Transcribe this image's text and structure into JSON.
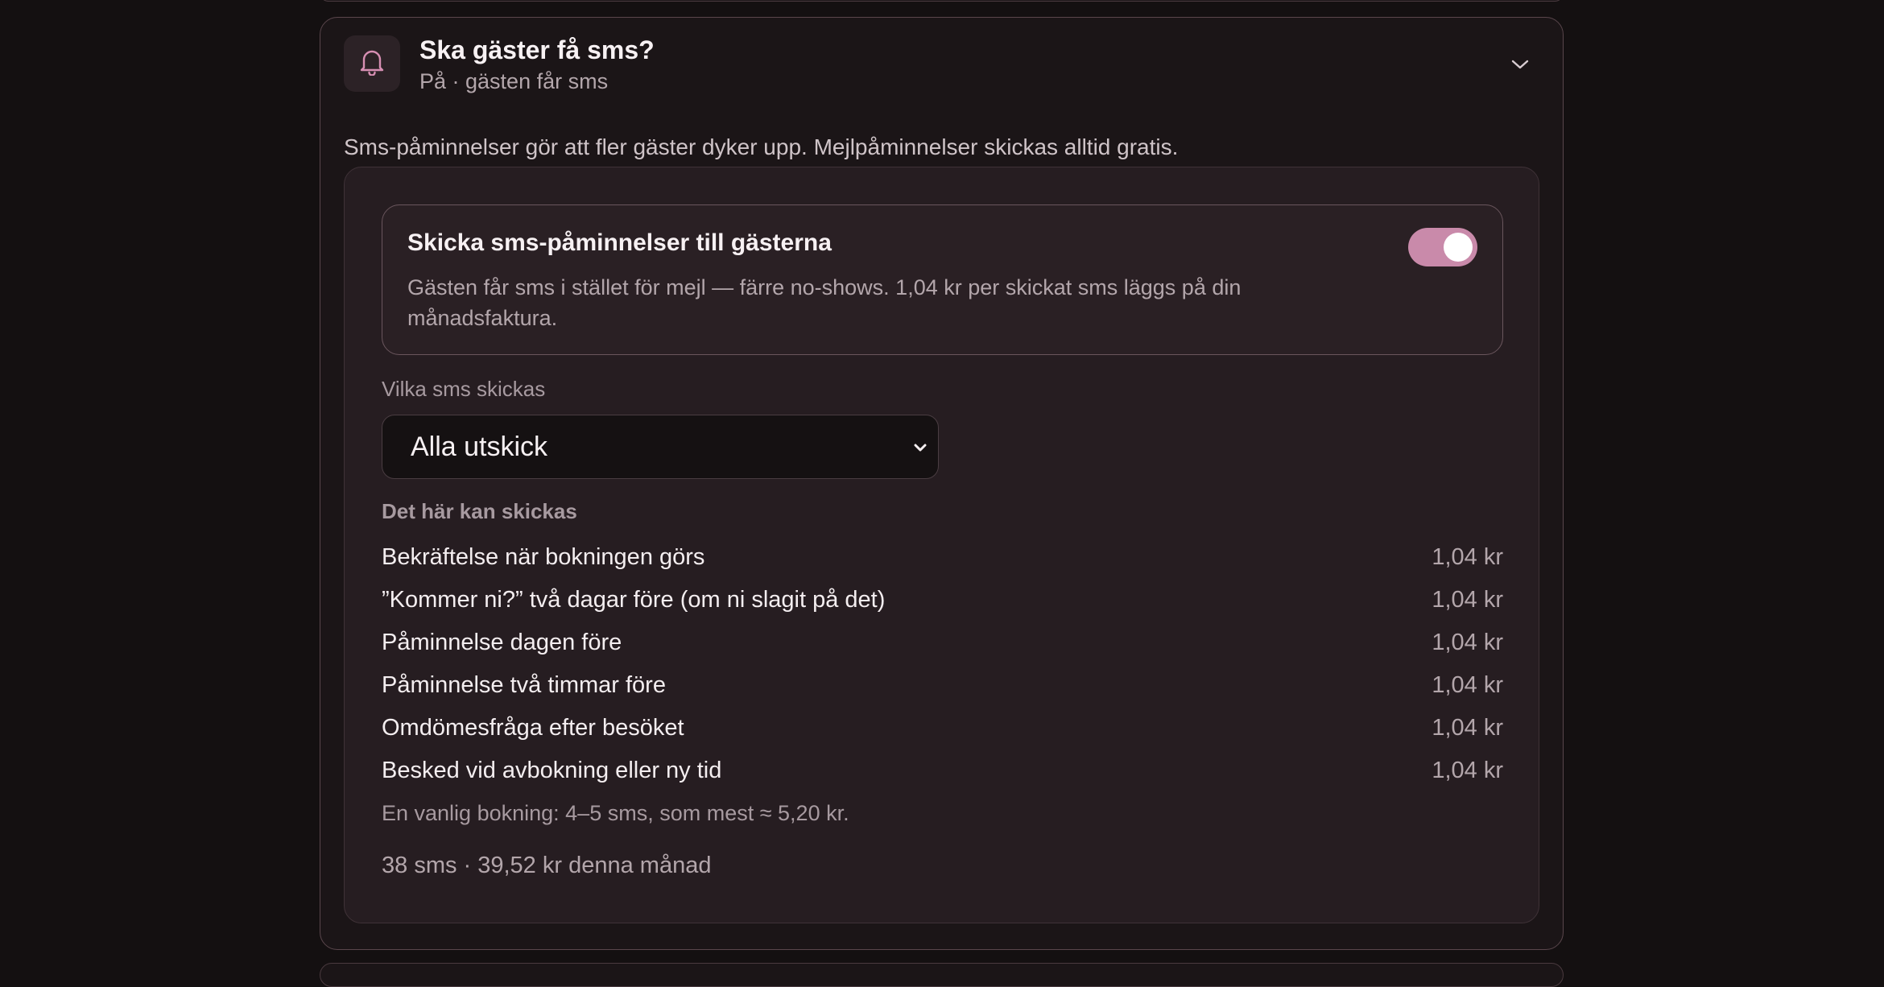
{
  "card": {
    "title": "Ska gäster få sms?",
    "subtitle": "På · gästen får sms",
    "description": "Sms‑påminnelser gör att fler gäster dyker upp. Mejlpåminnelser skickas alltid gratis."
  },
  "toggle": {
    "title": "Skicka sms‑påminnelser till gästerna",
    "description": "Gästen får sms i stället för mejl — färre no‑shows. 1,04 kr per skickat sms läggs på din månadsfaktura.",
    "enabled": true,
    "accent_color": "#c98aaa"
  },
  "select": {
    "label": "Vilka sms skickas",
    "value": "Alla utskick"
  },
  "list": {
    "heading": "Det här kan skickas",
    "items": [
      {
        "label": "Bekräftelse när bokningen görs",
        "price": "1,04 kr"
      },
      {
        "label": "”Kommer ni?” två dagar före (om ni slagit på det)",
        "price": "1,04 kr"
      },
      {
        "label": "Påminnelse dagen före",
        "price": "1,04 kr"
      },
      {
        "label": "Påminnelse två timmar före",
        "price": "1,04 kr"
      },
      {
        "label": "Omdömesfråga efter besöket",
        "price": "1,04 kr"
      },
      {
        "label": "Besked vid avbokning eller ny tid",
        "price": "1,04 kr"
      }
    ]
  },
  "note": "En vanlig bokning: 4–5 sms, som mest ≈ 5,20 kr.",
  "usage": "38 sms · 39,52 kr denna månad",
  "icons": {
    "header": "bell-icon",
    "collapse": "chevron-down-icon",
    "select": "chevron-down-icon"
  }
}
